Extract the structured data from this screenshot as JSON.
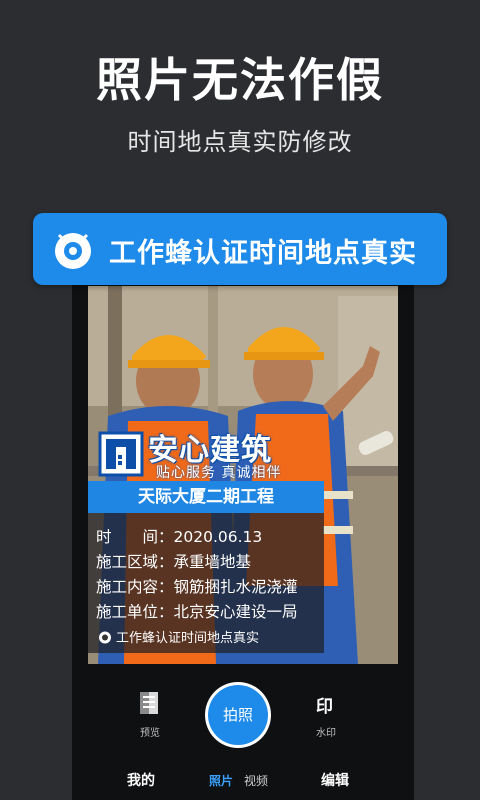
{
  "promo": {
    "headline": "照片无法作假",
    "subline": "时间地点真实防修改",
    "banner_text": "工作蜂认证时间地点真实"
  },
  "watermark": {
    "brand_name": "安心建筑",
    "brand_slogan": "贴心服务 真诚相伴",
    "project_title": "天际大厦二期工程",
    "rows": [
      {
        "label": "时　　间：",
        "value": "2020.06.13"
      },
      {
        "label": "施工区域：",
        "value": "承重墙地基"
      },
      {
        "label": "施工内容：",
        "value": "钢筋捆扎水泥浇灌"
      },
      {
        "label": "施工单位：",
        "value": "北京安心建设一局"
      }
    ],
    "certified_text": "工作蜂认证时间地点真实"
  },
  "camera": {
    "preview_label": "预览",
    "shutter_label": "拍照",
    "watermark_icon_glyph": "印",
    "watermark_label": "水印"
  },
  "tabs": {
    "mine": "我的",
    "photo": "照片",
    "video": "视频",
    "edit": "编辑"
  },
  "colors": {
    "background": "#2b2d30",
    "accent_blue": "#1e8bea",
    "active_tab": "#3aa0ff"
  }
}
